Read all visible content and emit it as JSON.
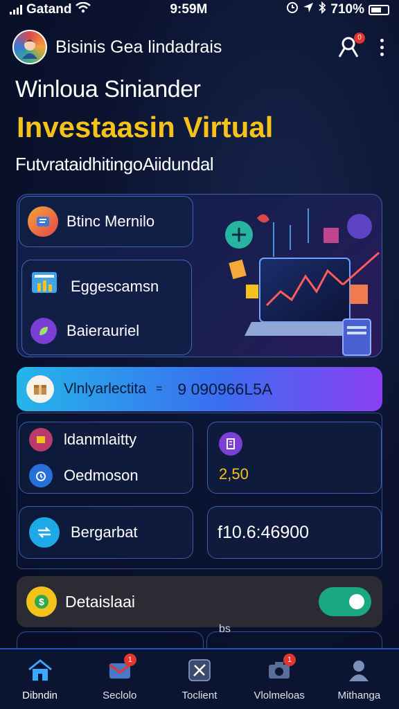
{
  "status_bar": {
    "carrier": "Gatand",
    "time": "9:59M",
    "battery": "710%"
  },
  "header": {
    "app_title": "Bisinis Gea lindadrais",
    "notification_count": "0"
  },
  "hero_text": {
    "subtitle_1": "Winloua Siniander",
    "headline": "Investaasin Virtual",
    "subtitle_2": "FutvrataidhitingoAiidundal"
  },
  "hero_cards": {
    "card_1_label": "Btinc Mernilo",
    "card_2_row_1": "Eggescamsn",
    "card_2_row_2": "Baierauriel"
  },
  "balance_bar": {
    "label": "Vlnlyarlectita",
    "separator": "=",
    "value": "9 090966L5A"
  },
  "tiles": {
    "left_top_row_1": "ldanmlaitty",
    "left_top_row_2": "Oedmoson",
    "right_top_value": "2,50",
    "left_bottom": "Bergarbat",
    "right_bottom_value": "f10.6:46900"
  },
  "toggle_row": {
    "label": "Detaislaai",
    "enabled": true
  },
  "peek_text": "bs",
  "tabbar": {
    "tabs": [
      {
        "label": "Dibndin",
        "icon": "home-icon",
        "badge": ""
      },
      {
        "label": "Seclolo",
        "icon": "mail-icon",
        "badge": "1"
      },
      {
        "label": "Toclient",
        "icon": "tools-icon",
        "badge": ""
      },
      {
        "label": "Vlolmeloas",
        "icon": "camera-icon",
        "badge": "1"
      },
      {
        "label": "Mithanga",
        "icon": "profile-icon",
        "badge": ""
      }
    ]
  },
  "colors": {
    "accent_yellow": "#f5c21b",
    "toggle_green": "#19a882",
    "badge_red": "#e3342f"
  }
}
